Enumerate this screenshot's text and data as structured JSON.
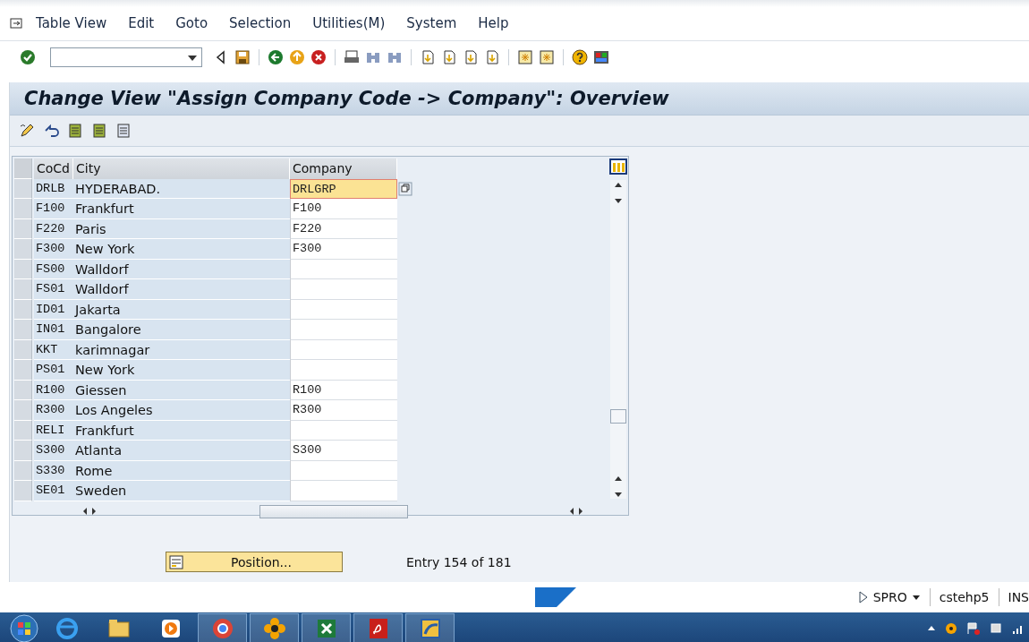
{
  "menu": [
    {
      "label": "Table View"
    },
    {
      "label": "Edit"
    },
    {
      "label": "Goto"
    },
    {
      "label": "Selection"
    },
    {
      "label": "Utilities(M)"
    },
    {
      "label": "System"
    },
    {
      "label": "Help"
    }
  ],
  "title": "Change View \"Assign Company Code -> Company\": Overview",
  "table": {
    "columns": [
      "CoCd",
      "City",
      "Company"
    ],
    "rows": [
      {
        "cocd": "DRLB",
        "city": "HYDERABAD.",
        "company": "DRLGRP",
        "focused": true
      },
      {
        "cocd": "F100",
        "city": "Frankfurt",
        "company": "F100",
        "focused": false
      },
      {
        "cocd": "F220",
        "city": "Paris",
        "company": "F220",
        "focused": false
      },
      {
        "cocd": "F300",
        "city": "New York",
        "company": "F300",
        "focused": false
      },
      {
        "cocd": "FS00",
        "city": "Walldorf",
        "company": "",
        "focused": false
      },
      {
        "cocd": "FS01",
        "city": "Walldorf",
        "company": "",
        "focused": false
      },
      {
        "cocd": "ID01",
        "city": "Jakarta",
        "company": "",
        "focused": false
      },
      {
        "cocd": "IN01",
        "city": "Bangalore",
        "company": "",
        "focused": false
      },
      {
        "cocd": "KKT",
        "city": "karimnagar",
        "company": "",
        "focused": false
      },
      {
        "cocd": "PS01",
        "city": "New York",
        "company": "",
        "focused": false
      },
      {
        "cocd": "R100",
        "city": "Giessen",
        "company": "R100",
        "focused": false
      },
      {
        "cocd": "R300",
        "city": "Los Angeles",
        "company": "R300",
        "focused": false
      },
      {
        "cocd": "RELI",
        "city": "Frankfurt",
        "company": "",
        "focused": false
      },
      {
        "cocd": "S300",
        "city": "Atlanta",
        "company": "S300",
        "focused": false
      },
      {
        "cocd": "S330",
        "city": "Rome",
        "company": "",
        "focused": false
      },
      {
        "cocd": "SE01",
        "city": "Sweden",
        "company": "",
        "focused": false
      }
    ]
  },
  "position_button": "Position...",
  "entry_info": "Entry 154 of 181",
  "status_bar": {
    "transaction": "SPRO",
    "server": "cstehp5",
    "mode": "INS"
  }
}
